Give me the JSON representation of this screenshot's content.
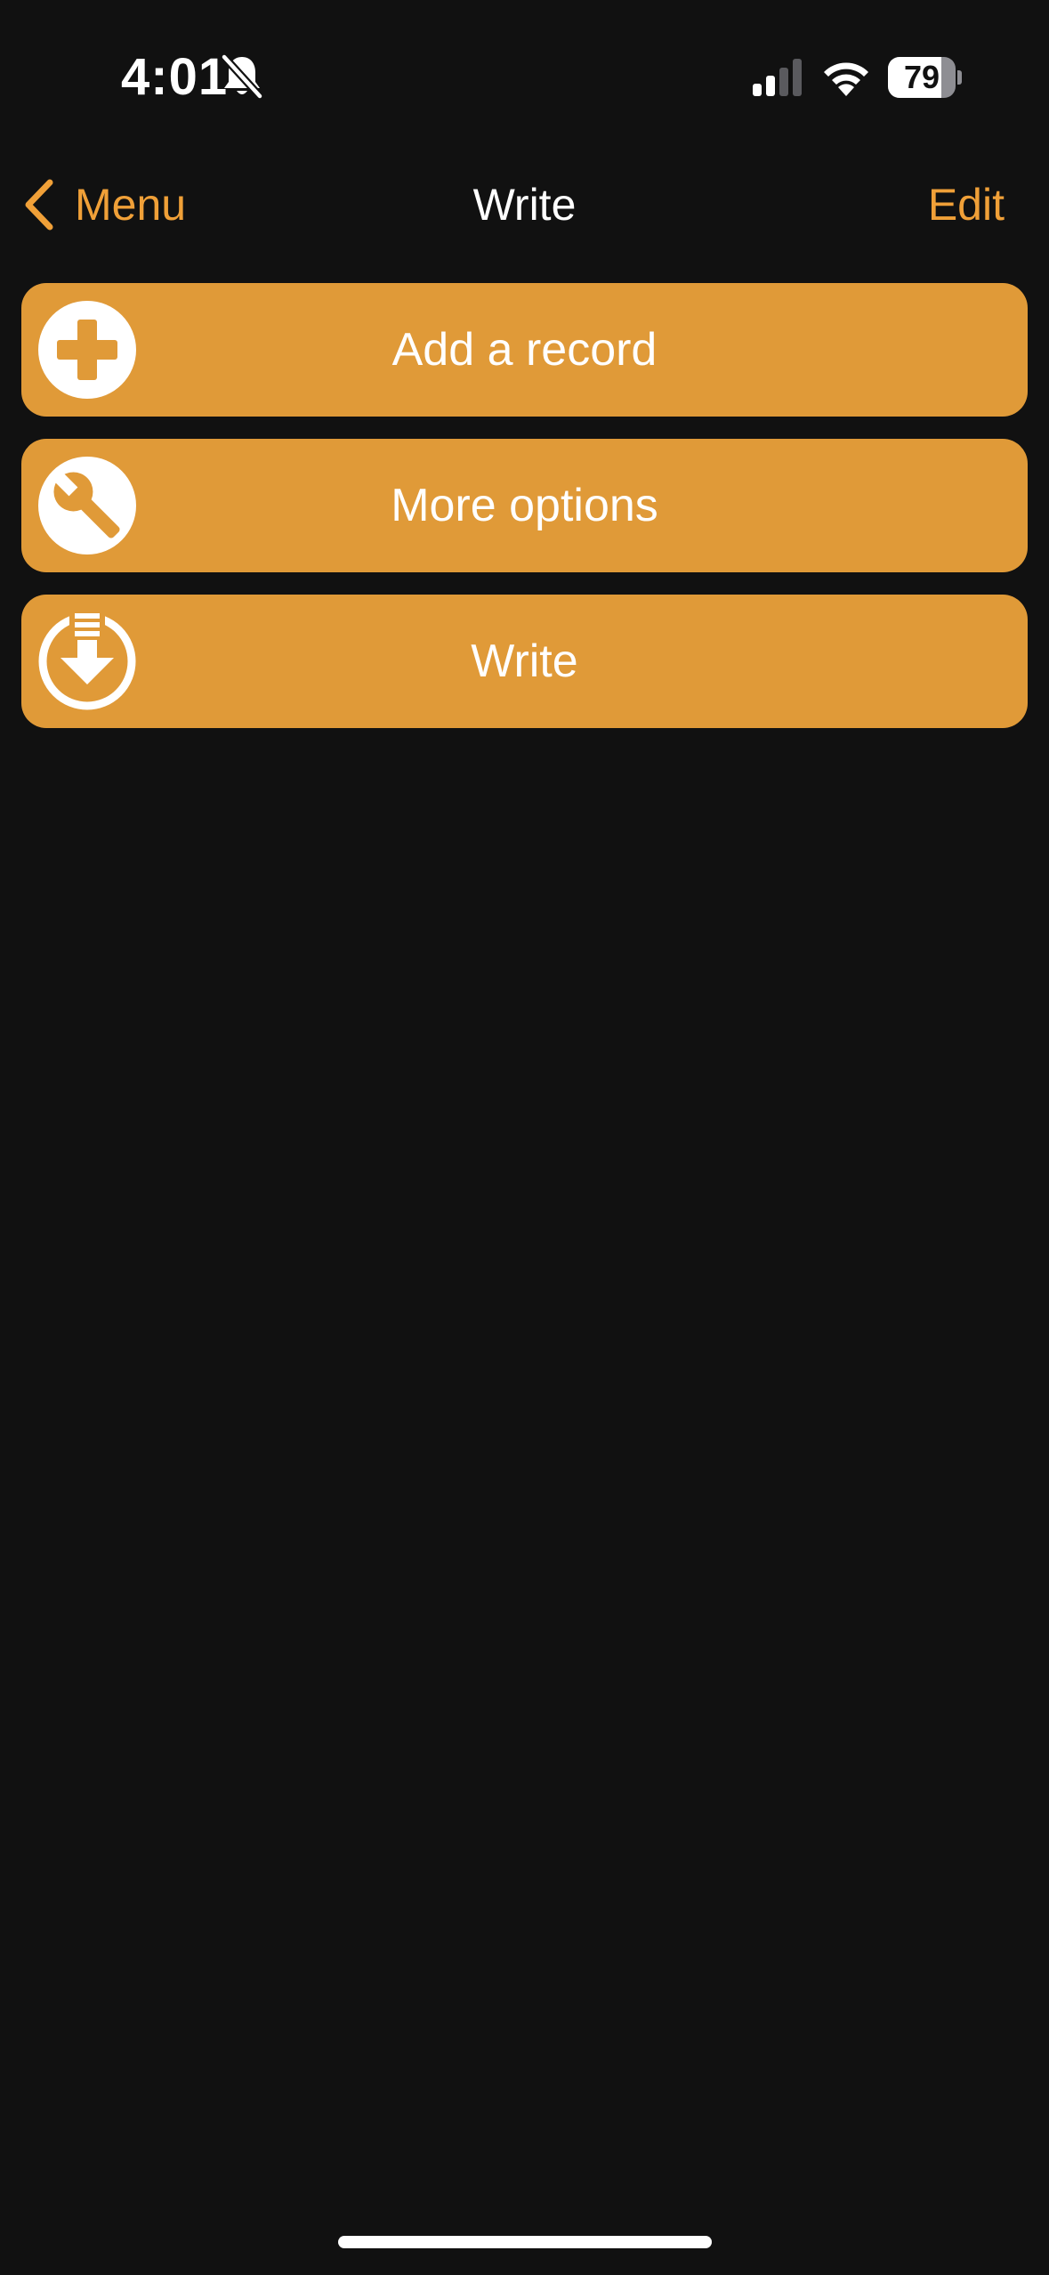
{
  "status_bar": {
    "time": "4:01",
    "battery_level": 79,
    "battery_text": "79",
    "silent_icon": "bell-slash-icon",
    "signal_icon": "cellular-signal-icon",
    "wifi_icon": "wifi-icon"
  },
  "nav": {
    "back_label": "Menu",
    "title": "Write",
    "edit_label": "Edit"
  },
  "actions": [
    {
      "label": "Add a record",
      "icon": "plus-circle-icon"
    },
    {
      "label": "More options",
      "icon": "wrench-icon"
    },
    {
      "label": "Write",
      "icon": "download-arrow-icon"
    }
  ],
  "colors": {
    "background": "#111111",
    "accent": "#f0a038",
    "button_fill": "#e09a38",
    "text": "#ffffff"
  }
}
